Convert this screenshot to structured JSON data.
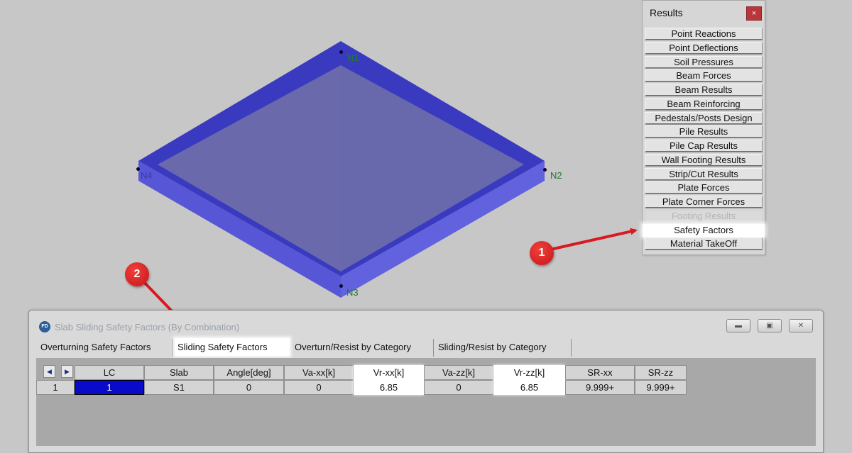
{
  "viewport": {
    "nodes": [
      "N1",
      "N2",
      "N3",
      "N4"
    ],
    "slab_color": "#4c4cd0"
  },
  "results_panel": {
    "title": "Results",
    "close_label": "×",
    "items": [
      {
        "label": "Point Reactions",
        "state": "normal"
      },
      {
        "label": "Point Deflections",
        "state": "normal"
      },
      {
        "label": "Soil Pressures",
        "state": "normal"
      },
      {
        "label": "Beam Forces",
        "state": "normal"
      },
      {
        "label": "Beam Results",
        "state": "normal"
      },
      {
        "label": "Beam Reinforcing",
        "state": "normal"
      },
      {
        "label": "Pedestals/Posts Design",
        "state": "normal"
      },
      {
        "label": "Pile Results",
        "state": "normal"
      },
      {
        "label": "Pile Cap Results",
        "state": "normal"
      },
      {
        "label": "Wall Footing Results",
        "state": "normal"
      },
      {
        "label": "Strip/Cut Results",
        "state": "normal"
      },
      {
        "label": "Plate Forces",
        "state": "normal"
      },
      {
        "label": "Plate Corner Forces",
        "state": "normal"
      },
      {
        "label": "Footing Results",
        "state": "disabled"
      },
      {
        "label": "Safety Factors",
        "state": "highlight"
      },
      {
        "label": "Material TakeOff",
        "state": "normal"
      }
    ]
  },
  "callouts": [
    "1",
    "2"
  ],
  "callout_color": "#d8191f",
  "dialog": {
    "app_icon": "FD",
    "title": "Slab Sliding Safety Factors (By Combination)",
    "window_buttons": [
      "minimize-icon",
      "restore-icon",
      "close-icon"
    ],
    "tabs": [
      "Overturning Safety Factors",
      "Sliding Safety Factors",
      "Overturn/Resist by Category",
      "Sliding/Resist by Category"
    ],
    "active_tab": 1,
    "table": {
      "columns": [
        "LC",
        "Slab",
        "Angle[deg]",
        "Va-xx[k]",
        "Vr-xx[k]",
        "Va-zz[k]",
        "Vr-zz[k]",
        "SR-xx",
        "SR-zz"
      ],
      "rows": [
        {
          "row_number": "1",
          "cells": [
            "1",
            "S1",
            "0",
            "0",
            "6.85",
            "0",
            "6.85",
            "9.999+",
            "9.999+"
          ]
        }
      ]
    }
  }
}
